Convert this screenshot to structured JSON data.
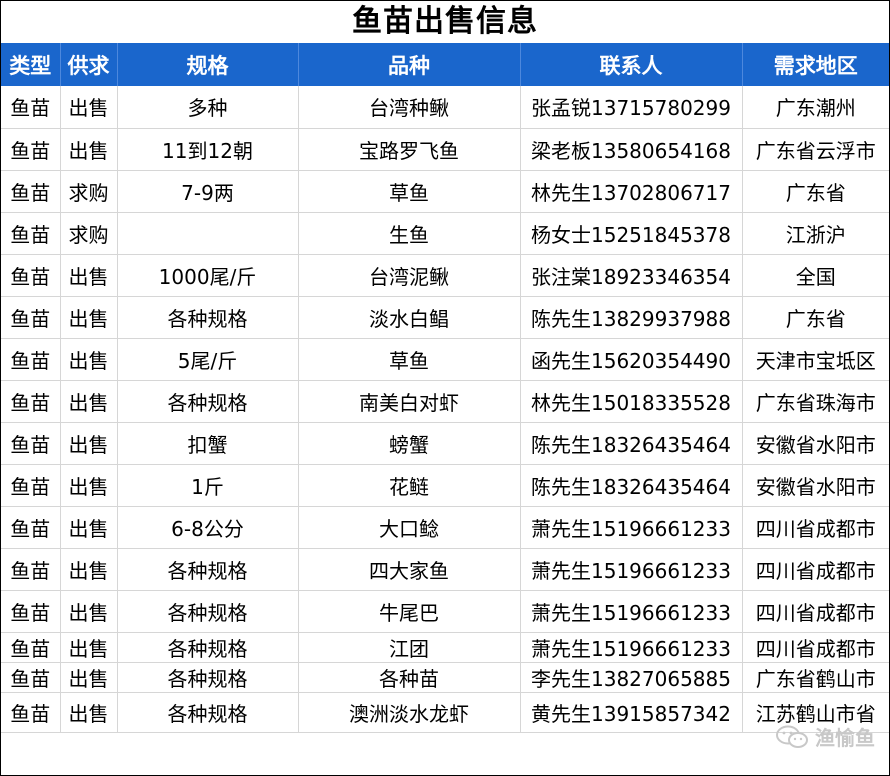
{
  "title": "鱼苗出售信息",
  "columns": [
    "类型",
    "供求",
    "规格",
    "品种",
    "联系人",
    "需求地区"
  ],
  "rows": [
    [
      "鱼苗",
      "出售",
      "多种",
      "台湾种鳅",
      "张孟锐13715780299",
      "广东潮州"
    ],
    [
      "鱼苗",
      "出售",
      "11到12朝",
      "宝路罗飞鱼",
      "梁老板13580654168",
      "广东省云浮市"
    ],
    [
      "鱼苗",
      "求购",
      "7-9两",
      "草鱼",
      "林先生13702806717",
      "广东省"
    ],
    [
      "鱼苗",
      "求购",
      "",
      "生鱼",
      "杨女士15251845378",
      "江浙沪"
    ],
    [
      "鱼苗",
      "出售",
      "1000尾/斤",
      "台湾泥鳅",
      "张注棠18923346354",
      "全国"
    ],
    [
      "鱼苗",
      "出售",
      "各种规格",
      "淡水白鲳",
      "陈先生13829937988",
      "广东省"
    ],
    [
      "鱼苗",
      "出售",
      "5尾/斤",
      "草鱼",
      "函先生15620354490",
      "天津市宝坻区"
    ],
    [
      "鱼苗",
      "出售",
      "各种规格",
      "南美白对虾",
      "林先生15018335528",
      "广东省珠海市"
    ],
    [
      "鱼苗",
      "出售",
      "扣蟹",
      "螃蟹",
      "陈先生18326435464",
      "安徽省水阳市"
    ],
    [
      "鱼苗",
      "出售",
      "1斤",
      "花鲢",
      "陈先生18326435464",
      "安徽省水阳市"
    ],
    [
      "鱼苗",
      "出售",
      "6-8公分",
      "大口鲶",
      "萧先生15196661233",
      "四川省成都市"
    ],
    [
      "鱼苗",
      "出售",
      "各种规格",
      "四大家鱼",
      "萧先生15196661233",
      "四川省成都市"
    ],
    [
      "鱼苗",
      "出售",
      "各种规格",
      "牛尾巴",
      "萧先生15196661233",
      "四川省成都市"
    ],
    [
      "鱼苗",
      "出售",
      "各种规格",
      "江团",
      "萧先生15196661233",
      "四川省成都市"
    ],
    [
      "鱼苗",
      "出售",
      "各种规格",
      "各种苗",
      "李先生13827065885",
      "广东省鹤山市"
    ],
    [
      "鱼苗",
      "出售",
      "各种规格",
      "澳洲淡水龙虾",
      "黄先生13915857342",
      "江苏鹤山市省"
    ]
  ],
  "watermark": {
    "text": "渔愉鱼",
    "icon": "wechat-icon"
  },
  "colors": {
    "header_bg": "#1a66cc",
    "header_text": "#ffffff",
    "grid": "#d6d6d6"
  }
}
